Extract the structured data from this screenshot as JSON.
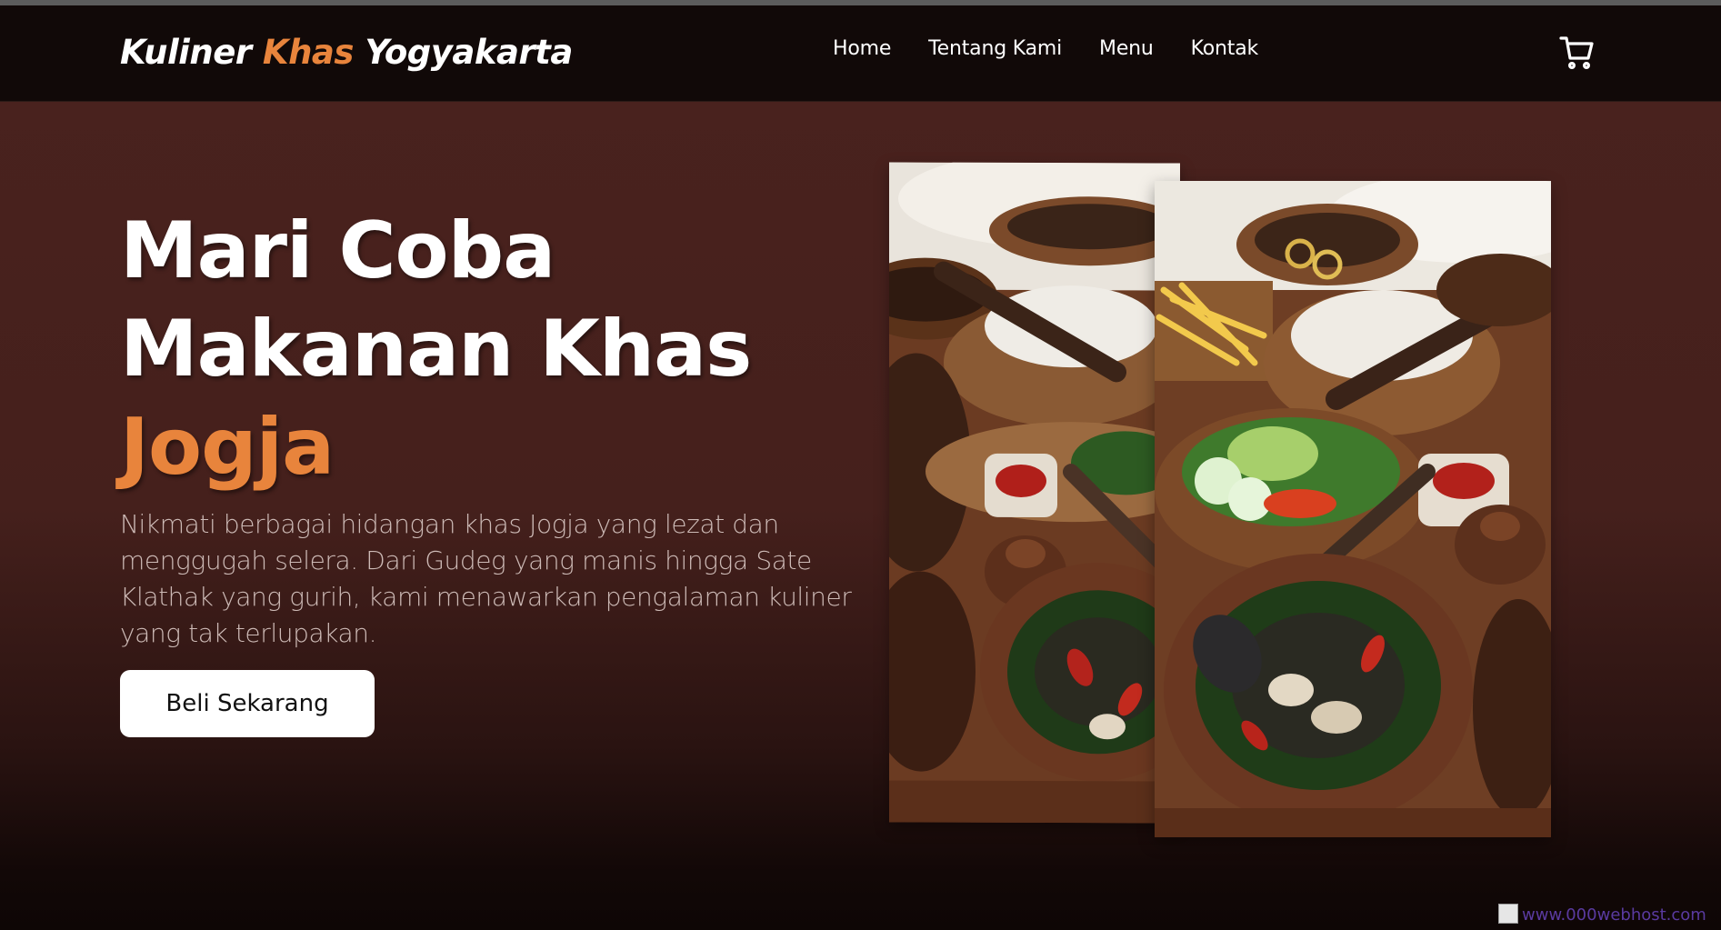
{
  "header": {
    "logo": {
      "part1": "Kuliner ",
      "part2": "Khas",
      "part3": " Yogyakarta"
    },
    "nav": [
      "Home",
      "Tentang Kami",
      "Menu",
      "Kontak"
    ],
    "cart_icon": "shopping-cart-icon"
  },
  "hero": {
    "title_line1": "Mari Coba",
    "title_line2": "Makanan Khas",
    "title_line3": "Jogja",
    "description": "Nikmati berbagai hidangan khas Jogja yang lezat dan menggugah selera. Dari Gudeg yang manis hingga Sate Klathak yang gurih, kami menawarkan pengalaman kuliner yang tak terlupakan.",
    "cta_label": "Beli Sekarang"
  },
  "footer": {
    "badge_text": "www.000webhost.com"
  },
  "colors": {
    "accent": "#e8843c",
    "navbar_bg": "#110908",
    "hero_bg": "#4a221e",
    "button_bg": "#ffffff"
  }
}
